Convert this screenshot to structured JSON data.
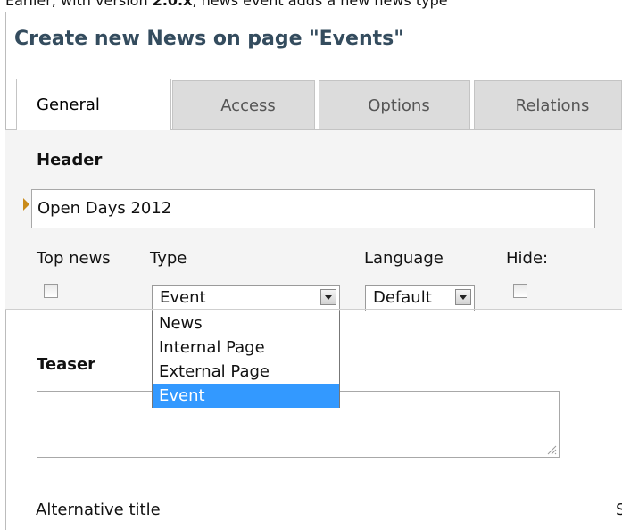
{
  "intro": {
    "pre": "Earlier, with version ",
    "version": "2.0.x",
    "post": ", news event adds a new news type"
  },
  "form": {
    "title": "Create new News on page \"Events\"",
    "tabs": [
      "General",
      "Access",
      "Options",
      "Relations"
    ],
    "active_tab": "General",
    "header_label": "Header",
    "header_value": "Open Days 2012",
    "top_news_label": "Top news",
    "type_label": "Type",
    "type_value": "Event",
    "type_options": [
      "News",
      "Internal Page",
      "External Page",
      "Event"
    ],
    "type_selected": "Event",
    "language_label": "Language",
    "language_value": "Default",
    "hide_label": "Hide:",
    "teaser_label": "Teaser",
    "alt_title_label": "Alternative title",
    "cut_right_text": "S"
  },
  "colors": {
    "title": "#344c5e",
    "marker": "#c98a18",
    "selection": "#3399ff",
    "tab_inactive": "#dcdcdc"
  },
  "icons": {
    "required_marker": "triangle-right",
    "dropdown": "chevron-down",
    "resize": "resize-grip"
  }
}
